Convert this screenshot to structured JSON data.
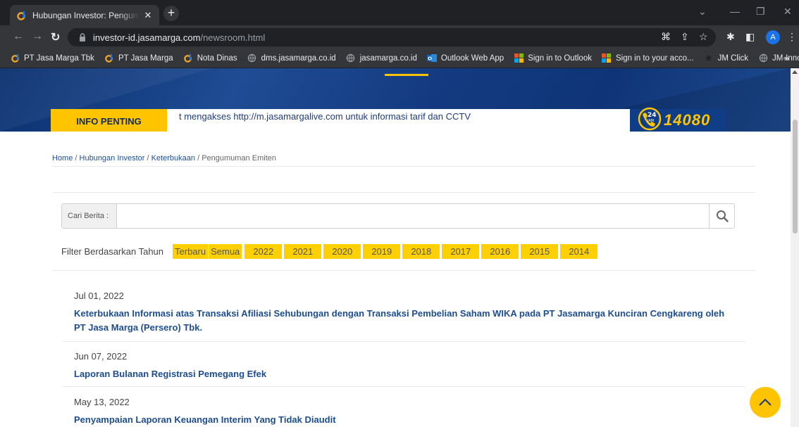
{
  "browser": {
    "tab_title": "Hubungan Investor: Pengumuman",
    "url_host": "investor-id.jasamarga.com",
    "url_path": "/newsroom.html",
    "profile_initial": "A",
    "bookmarks": [
      {
        "label": "PT Jasa Marga Tbk",
        "icon": "jasamarga-logo"
      },
      {
        "label": "PT Jasa Marga",
        "icon": "jasamarga-logo"
      },
      {
        "label": "Nota Dinas",
        "icon": "jasamarga-logo"
      },
      {
        "label": "dms.jasamarga.co.id",
        "icon": "globe"
      },
      {
        "label": "jasamarga.co.id",
        "icon": "globe"
      },
      {
        "label": "Outlook Web App",
        "icon": "outlook"
      },
      {
        "label": "Sign in to Outlook",
        "icon": "microsoft"
      },
      {
        "label": "Sign in to your acco...",
        "icon": "microsoft"
      },
      {
        "label": "JM Click",
        "icon": "star"
      },
      {
        "label": "JM-Innov",
        "icon": "globe"
      }
    ]
  },
  "info": {
    "label": "INFO PENTING",
    "text": "t mengakses http://m.jasamargalive.com untuk informasi tarif dan CCTV",
    "hotline_badge_top": "24",
    "hotline_badge_bottom": "JAM",
    "hotline": "14080"
  },
  "breadcrumb": {
    "home": "Home",
    "sep": " / ",
    "investor": "Hubungan Investor",
    "disclosure": "Keterbukaan",
    "current": "Pengumuman Emiten"
  },
  "search": {
    "label": "Cari Berita :",
    "value": "",
    "placeholder": ""
  },
  "filter": {
    "label": "Filter Berdasarkan Tahun",
    "latest": "Terbaru",
    "all": "Semua",
    "years": [
      "2022",
      "2021",
      "2020",
      "2019",
      "2018",
      "2017",
      "2016",
      "2015",
      "2014"
    ]
  },
  "news": [
    {
      "date": "Jul 01, 2022",
      "title": "Keterbukaan Informasi atas Transaksi Afiliasi Sehubungan dengan Transaksi Pembelian Saham WIKA pada PT Jasamarga Kunciran Cengkareng oleh PT Jasa Marga (Persero) Tbk."
    },
    {
      "date": "Jun 07, 2022",
      "title": "Laporan Bulanan Registrasi Pemegang Efek"
    },
    {
      "date": "May 13, 2022",
      "title": "Penyampaian Laporan Keuangan Interim Yang Tidak Diaudit"
    }
  ],
  "colors": {
    "accent_yellow": "#ffc400",
    "brand_blue": "#0f3d86",
    "link_blue": "#1d4d8f"
  }
}
